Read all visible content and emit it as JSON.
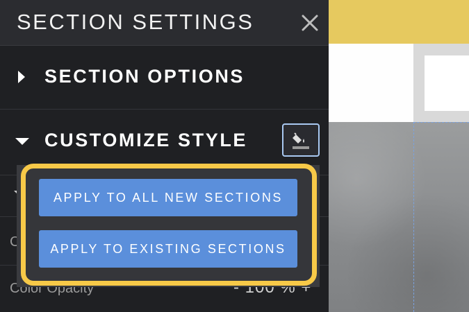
{
  "panel": {
    "title": "SECTION SETTINGS",
    "close_icon": "close-icon"
  },
  "sections": {
    "options_label": "SECTION OPTIONS",
    "customize_label": "CUSTOMIZE STYLE",
    "paint_icon": "paint-bucket-icon"
  },
  "popup": {
    "apply_new_label": "APPLY TO ALL NEW SECTIONS",
    "apply_existing_label": "APPLY TO EXISTING SECTIONS",
    "highlight_color": "#f7c948",
    "button_color": "#5b8fdb"
  },
  "background_rows": {
    "row_b_label": "C",
    "row_c_label": "Color Opacity",
    "opacity_value": "- 100 % +"
  },
  "colors": {
    "panel_bg": "#1f2023",
    "header_bg": "#2b2c30",
    "canvas_topbar": "#e6c95f"
  }
}
